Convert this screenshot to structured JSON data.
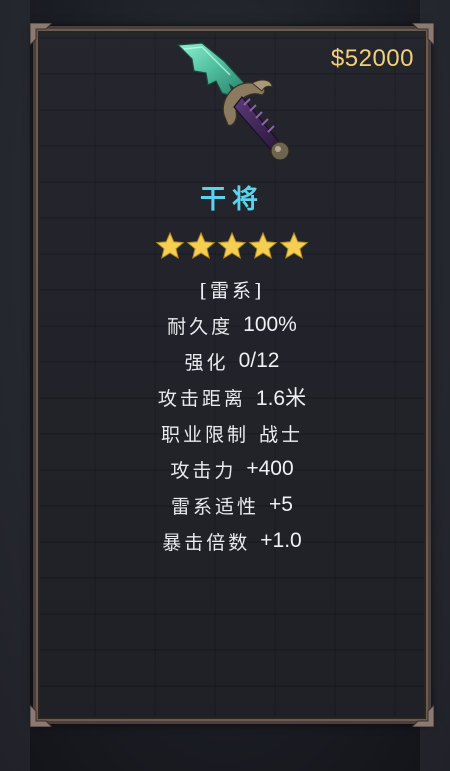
{
  "shop": {
    "price": "$52000"
  },
  "item": {
    "name": "干将",
    "rarity_stars": 5,
    "element_tag": "[雷系]",
    "icon": "dagger-icon"
  },
  "stats": [
    {
      "label": "耐久度",
      "value": "100%"
    },
    {
      "label": "强化",
      "value": "0/12"
    },
    {
      "label": "攻击距离",
      "value": "1.6米"
    },
    {
      "label": "职业限制",
      "value": "战士"
    },
    {
      "label": "攻击力",
      "value": "+400"
    },
    {
      "label": "雷系适性",
      "value": "+5"
    },
    {
      "label": "暴击倍数",
      "value": "+1.0"
    }
  ],
  "colors": {
    "price": "#f2d077",
    "name": "#5ad4ee",
    "star": "#f5cf52",
    "blade": "#6ed6b6",
    "frame": "#4a3f3a"
  }
}
